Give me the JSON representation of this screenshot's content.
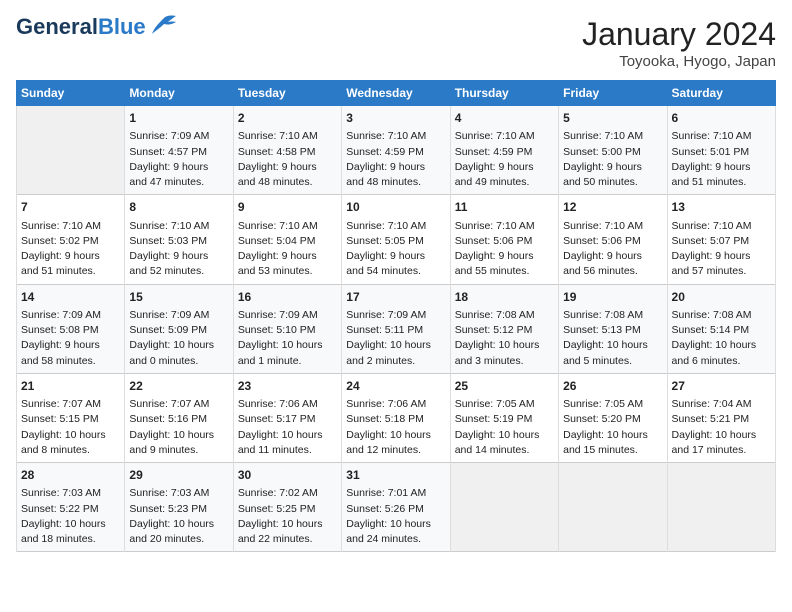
{
  "logo": {
    "line1": "General",
    "line2": "Blue"
  },
  "title": "January 2024",
  "subtitle": "Toyooka, Hyogo, Japan",
  "days_header": [
    "Sunday",
    "Monday",
    "Tuesday",
    "Wednesday",
    "Thursday",
    "Friday",
    "Saturday"
  ],
  "weeks": [
    [
      {
        "day": "",
        "info": ""
      },
      {
        "day": "1",
        "info": "Sunrise: 7:09 AM\nSunset: 4:57 PM\nDaylight: 9 hours\nand 47 minutes."
      },
      {
        "day": "2",
        "info": "Sunrise: 7:10 AM\nSunset: 4:58 PM\nDaylight: 9 hours\nand 48 minutes."
      },
      {
        "day": "3",
        "info": "Sunrise: 7:10 AM\nSunset: 4:59 PM\nDaylight: 9 hours\nand 48 minutes."
      },
      {
        "day": "4",
        "info": "Sunrise: 7:10 AM\nSunset: 4:59 PM\nDaylight: 9 hours\nand 49 minutes."
      },
      {
        "day": "5",
        "info": "Sunrise: 7:10 AM\nSunset: 5:00 PM\nDaylight: 9 hours\nand 50 minutes."
      },
      {
        "day": "6",
        "info": "Sunrise: 7:10 AM\nSunset: 5:01 PM\nDaylight: 9 hours\nand 51 minutes."
      }
    ],
    [
      {
        "day": "7",
        "info": "Sunrise: 7:10 AM\nSunset: 5:02 PM\nDaylight: 9 hours\nand 51 minutes."
      },
      {
        "day": "8",
        "info": "Sunrise: 7:10 AM\nSunset: 5:03 PM\nDaylight: 9 hours\nand 52 minutes."
      },
      {
        "day": "9",
        "info": "Sunrise: 7:10 AM\nSunset: 5:04 PM\nDaylight: 9 hours\nand 53 minutes."
      },
      {
        "day": "10",
        "info": "Sunrise: 7:10 AM\nSunset: 5:05 PM\nDaylight: 9 hours\nand 54 minutes."
      },
      {
        "day": "11",
        "info": "Sunrise: 7:10 AM\nSunset: 5:06 PM\nDaylight: 9 hours\nand 55 minutes."
      },
      {
        "day": "12",
        "info": "Sunrise: 7:10 AM\nSunset: 5:06 PM\nDaylight: 9 hours\nand 56 minutes."
      },
      {
        "day": "13",
        "info": "Sunrise: 7:10 AM\nSunset: 5:07 PM\nDaylight: 9 hours\nand 57 minutes."
      }
    ],
    [
      {
        "day": "14",
        "info": "Sunrise: 7:09 AM\nSunset: 5:08 PM\nDaylight: 9 hours\nand 58 minutes."
      },
      {
        "day": "15",
        "info": "Sunrise: 7:09 AM\nSunset: 5:09 PM\nDaylight: 10 hours\nand 0 minutes."
      },
      {
        "day": "16",
        "info": "Sunrise: 7:09 AM\nSunset: 5:10 PM\nDaylight: 10 hours\nand 1 minute."
      },
      {
        "day": "17",
        "info": "Sunrise: 7:09 AM\nSunset: 5:11 PM\nDaylight: 10 hours\nand 2 minutes."
      },
      {
        "day": "18",
        "info": "Sunrise: 7:08 AM\nSunset: 5:12 PM\nDaylight: 10 hours\nand 3 minutes."
      },
      {
        "day": "19",
        "info": "Sunrise: 7:08 AM\nSunset: 5:13 PM\nDaylight: 10 hours\nand 5 minutes."
      },
      {
        "day": "20",
        "info": "Sunrise: 7:08 AM\nSunset: 5:14 PM\nDaylight: 10 hours\nand 6 minutes."
      }
    ],
    [
      {
        "day": "21",
        "info": "Sunrise: 7:07 AM\nSunset: 5:15 PM\nDaylight: 10 hours\nand 8 minutes."
      },
      {
        "day": "22",
        "info": "Sunrise: 7:07 AM\nSunset: 5:16 PM\nDaylight: 10 hours\nand 9 minutes."
      },
      {
        "day": "23",
        "info": "Sunrise: 7:06 AM\nSunset: 5:17 PM\nDaylight: 10 hours\nand 11 minutes."
      },
      {
        "day": "24",
        "info": "Sunrise: 7:06 AM\nSunset: 5:18 PM\nDaylight: 10 hours\nand 12 minutes."
      },
      {
        "day": "25",
        "info": "Sunrise: 7:05 AM\nSunset: 5:19 PM\nDaylight: 10 hours\nand 14 minutes."
      },
      {
        "day": "26",
        "info": "Sunrise: 7:05 AM\nSunset: 5:20 PM\nDaylight: 10 hours\nand 15 minutes."
      },
      {
        "day": "27",
        "info": "Sunrise: 7:04 AM\nSunset: 5:21 PM\nDaylight: 10 hours\nand 17 minutes."
      }
    ],
    [
      {
        "day": "28",
        "info": "Sunrise: 7:03 AM\nSunset: 5:22 PM\nDaylight: 10 hours\nand 18 minutes."
      },
      {
        "day": "29",
        "info": "Sunrise: 7:03 AM\nSunset: 5:23 PM\nDaylight: 10 hours\nand 20 minutes."
      },
      {
        "day": "30",
        "info": "Sunrise: 7:02 AM\nSunset: 5:25 PM\nDaylight: 10 hours\nand 22 minutes."
      },
      {
        "day": "31",
        "info": "Sunrise: 7:01 AM\nSunset: 5:26 PM\nDaylight: 10 hours\nand 24 minutes."
      },
      {
        "day": "",
        "info": ""
      },
      {
        "day": "",
        "info": ""
      },
      {
        "day": "",
        "info": ""
      }
    ]
  ]
}
